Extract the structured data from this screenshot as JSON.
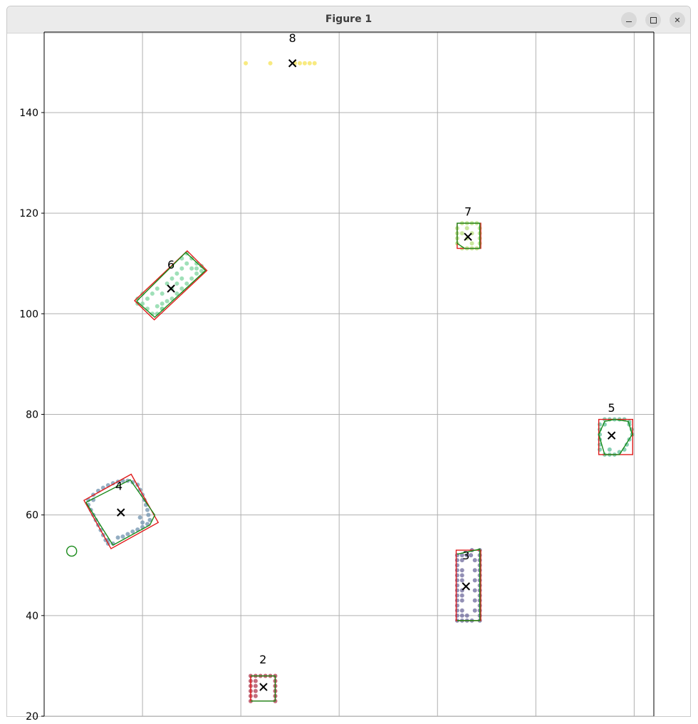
{
  "window": {
    "title": "Figure 1"
  },
  "controls": {
    "minimize": "minimize",
    "maximize": "maximize",
    "close": "close"
  },
  "chart_data": {
    "type": "scatter",
    "title": "",
    "xlabel": "",
    "ylabel": "",
    "xlim": [
      -4,
      120
    ],
    "ylim": [
      20,
      156
    ],
    "grid": true,
    "x_ticks": [
      16,
      36,
      56,
      76,
      96,
      116
    ],
    "y_ticks": [
      20,
      40,
      60,
      80,
      100,
      120,
      140
    ],
    "y_tick_labels": [
      "20",
      "40",
      "60",
      "80",
      "100",
      "120",
      "140"
    ],
    "colors": {
      "cluster_2": "#b13c52",
      "cluster_3": "#6d6a9c",
      "cluster_4": "#6f92ae",
      "cluster_5": "#5fbf9a",
      "cluster_6": "#7fd6a0",
      "cluster_7": "#b8df7d",
      "cluster_8": "#f5e356",
      "bounding_box": "#e01b1b",
      "hull": "#1a8a1a",
      "centroid": "#000000",
      "extra_circle": "#1a8a1a"
    },
    "extra_points": [
      {
        "x": 1.6,
        "y": 52.8,
        "marker": "open-circle"
      }
    ],
    "clusters": [
      {
        "label": "2",
        "centroid": [
          40.6,
          25.8
        ],
        "label_pos": [
          40.5,
          30.5
        ],
        "box": [
          [
            38,
            23
          ],
          [
            43,
            23
          ],
          [
            43,
            28
          ],
          [
            38,
            28
          ]
        ],
        "hull": [
          [
            38,
            23
          ],
          [
            43,
            23
          ],
          [
            43,
            28
          ],
          [
            38,
            28
          ]
        ],
        "points": [
          [
            38,
            23
          ],
          [
            38,
            24
          ],
          [
            38,
            25
          ],
          [
            38,
            26
          ],
          [
            38,
            27
          ],
          [
            38,
            28
          ],
          [
            39,
            28
          ],
          [
            40,
            28
          ],
          [
            41,
            28
          ],
          [
            42,
            28
          ],
          [
            43,
            28
          ],
          [
            43,
            27
          ],
          [
            43,
            26
          ],
          [
            43,
            25
          ],
          [
            43,
            24
          ],
          [
            43,
            23
          ],
          [
            39,
            24
          ],
          [
            39,
            25
          ],
          [
            39,
            26
          ],
          [
            39,
            27
          ]
        ]
      },
      {
        "label": "3",
        "centroid": [
          81.8,
          45.8
        ],
        "label_pos": [
          81.8,
          51.2
        ],
        "box": [
          [
            79.8,
            39
          ],
          [
            84.8,
            39
          ],
          [
            84.8,
            53
          ],
          [
            79.8,
            53
          ]
        ],
        "hull": [
          [
            80,
            39
          ],
          [
            84.6,
            39
          ],
          [
            84.6,
            53.2
          ],
          [
            80,
            52.2
          ]
        ],
        "points": [
          [
            80,
            39
          ],
          [
            80,
            40
          ],
          [
            80,
            41
          ],
          [
            80,
            42
          ],
          [
            80,
            43
          ],
          [
            80,
            44
          ],
          [
            80,
            45
          ],
          [
            80,
            46
          ],
          [
            80,
            47
          ],
          [
            80,
            48
          ],
          [
            80,
            49
          ],
          [
            80,
            50
          ],
          [
            80,
            51
          ],
          [
            80,
            52
          ],
          [
            84.6,
            39
          ],
          [
            84.6,
            40
          ],
          [
            84.6,
            41
          ],
          [
            84.6,
            42
          ],
          [
            84.6,
            43
          ],
          [
            84.6,
            44
          ],
          [
            84.6,
            45
          ],
          [
            84.6,
            46
          ],
          [
            84.6,
            47
          ],
          [
            84.6,
            48
          ],
          [
            84.6,
            49
          ],
          [
            84.6,
            50
          ],
          [
            84.6,
            51
          ],
          [
            84.6,
            52
          ],
          [
            84.6,
            53
          ],
          [
            81,
            39
          ],
          [
            82,
            39
          ],
          [
            83,
            39
          ],
          [
            81,
            52
          ],
          [
            82,
            52
          ],
          [
            83,
            53
          ],
          [
            81,
            41
          ],
          [
            81,
            43
          ],
          [
            81,
            45
          ],
          [
            81,
            47
          ],
          [
            81,
            49
          ],
          [
            81,
            51
          ],
          [
            83.6,
            41
          ],
          [
            83.6,
            43
          ],
          [
            83.6,
            45
          ],
          [
            83.6,
            47
          ],
          [
            83.6,
            49
          ],
          [
            83.6,
            51
          ],
          [
            81,
            40
          ],
          [
            81,
            44
          ],
          [
            81,
            48
          ],
          [
            82,
            40
          ],
          [
            82.8,
            52
          ]
        ]
      },
      {
        "label": "4",
        "centroid": [
          11.6,
          60.5
        ],
        "label_pos": [
          11.2,
          65
        ],
        "box": [
          [
            4.1,
            62.9
          ],
          [
            13.7,
            68.1
          ],
          [
            19.2,
            58.5
          ],
          [
            9.6,
            53.3
          ]
        ],
        "hull": [
          [
            4.5,
            62.5
          ],
          [
            13.5,
            67
          ],
          [
            18.5,
            60
          ],
          [
            17.5,
            58
          ],
          [
            10,
            54
          ],
          [
            4.5,
            62.5
          ]
        ],
        "points": [
          [
            5,
            63
          ],
          [
            6,
            64
          ],
          [
            7,
            64.8
          ],
          [
            8,
            65.4
          ],
          [
            9,
            65.9
          ],
          [
            10,
            66.3
          ],
          [
            11,
            66.6
          ],
          [
            12,
            66.8
          ],
          [
            13,
            66.8
          ],
          [
            5,
            62
          ],
          [
            5.5,
            61
          ],
          [
            6,
            60
          ],
          [
            6.5,
            59
          ],
          [
            7,
            58
          ],
          [
            7.5,
            57
          ],
          [
            8,
            56
          ],
          [
            8.5,
            55
          ],
          [
            9,
            54.3
          ],
          [
            10,
            54.3
          ],
          [
            11,
            55.5
          ],
          [
            12,
            55.7
          ],
          [
            13,
            56.2
          ],
          [
            14,
            56.7
          ],
          [
            15,
            57.1
          ],
          [
            16,
            57.6
          ],
          [
            17,
            58.2
          ],
          [
            17.5,
            59
          ],
          [
            17.2,
            60
          ],
          [
            17,
            61
          ],
          [
            16.7,
            62
          ],
          [
            16.4,
            63
          ],
          [
            16,
            64
          ],
          [
            15.5,
            65
          ],
          [
            15,
            66
          ],
          [
            14,
            66.5
          ],
          [
            6,
            63
          ],
          [
            9,
            55
          ],
          [
            16,
            58.5
          ],
          [
            15.5,
            59.5
          ]
        ]
      },
      {
        "label": "5",
        "centroid": [
          111.4,
          75.8
        ],
        "label_pos": [
          111.4,
          80.5
        ],
        "box": [
          [
            108.8,
            72
          ],
          [
            115.7,
            72
          ],
          [
            115.7,
            79
          ],
          [
            108.8,
            79
          ]
        ],
        "hull": [
          [
            110,
            72
          ],
          [
            113,
            72
          ],
          [
            115.6,
            76
          ],
          [
            114.8,
            78.6
          ],
          [
            112,
            79
          ],
          [
            110,
            78.6
          ],
          [
            108.8,
            76
          ],
          [
            110,
            72
          ]
        ],
        "points": [
          [
            109,
            73
          ],
          [
            109,
            74
          ],
          [
            109,
            75
          ],
          [
            109,
            76
          ],
          [
            109,
            77
          ],
          [
            109,
            78
          ],
          [
            110,
            72
          ],
          [
            111,
            72
          ],
          [
            112,
            72
          ],
          [
            110,
            79
          ],
          [
            111,
            79
          ],
          [
            112,
            79
          ],
          [
            113,
            79
          ],
          [
            114,
            79
          ],
          [
            115,
            78
          ],
          [
            115.5,
            77
          ],
          [
            115.6,
            76
          ],
          [
            115,
            75
          ],
          [
            114.5,
            74
          ],
          [
            114,
            73
          ],
          [
            113,
            72.5
          ],
          [
            110,
            78
          ],
          [
            111,
            73
          ],
          [
            115,
            78.5
          ]
        ]
      },
      {
        "label": "6",
        "centroid": [
          21.8,
          105
        ],
        "label_pos": [
          21.8,
          109
        ],
        "box": [
          [
            14.4,
            102.6
          ],
          [
            18.4,
            98.8
          ],
          [
            29.1,
            108.6
          ],
          [
            25.1,
            112.5
          ]
        ],
        "hull": [
          [
            14.8,
            102.5
          ],
          [
            18.5,
            99.3
          ],
          [
            28.8,
            108.6
          ],
          [
            24.8,
            112.2
          ],
          [
            14.8,
            102.5
          ]
        ],
        "points": [
          [
            15,
            103
          ],
          [
            16,
            102
          ],
          [
            17,
            101
          ],
          [
            18,
            100
          ],
          [
            19,
            100
          ],
          [
            20,
            101
          ],
          [
            16,
            104
          ],
          [
            17,
            103
          ],
          [
            15,
            102
          ],
          [
            19,
            101.5
          ],
          [
            20,
            102
          ],
          [
            21,
            102.5
          ],
          [
            22,
            103
          ],
          [
            23,
            104
          ],
          [
            24,
            105
          ],
          [
            25,
            106
          ],
          [
            26,
            107
          ],
          [
            27,
            108
          ],
          [
            28,
            108.5
          ],
          [
            26,
            109
          ],
          [
            25,
            110
          ],
          [
            24,
            111
          ],
          [
            25,
            112
          ],
          [
            26,
            111
          ],
          [
            27,
            110
          ],
          [
            28,
            109.5
          ],
          [
            22,
            105
          ],
          [
            21,
            106
          ],
          [
            20,
            104
          ],
          [
            23,
            106
          ],
          [
            24,
            107
          ],
          [
            22,
            107
          ],
          [
            23,
            108
          ],
          [
            24,
            109
          ],
          [
            27,
            109
          ],
          [
            20,
            101
          ],
          [
            18,
            104
          ],
          [
            19,
            105
          ]
        ]
      },
      {
        "label": "7",
        "centroid": [
          82.2,
          115.3
        ],
        "label_pos": [
          82.2,
          119.5
        ],
        "box": [
          [
            80,
            113
          ],
          [
            84.8,
            113
          ],
          [
            84.8,
            118
          ],
          [
            80,
            118
          ]
        ],
        "hull": [
          [
            80,
            114
          ],
          [
            81.5,
            113
          ],
          [
            84.6,
            113
          ],
          [
            84.6,
            118
          ],
          [
            80,
            118
          ],
          [
            80,
            114
          ]
        ],
        "points": [
          [
            80,
            114
          ],
          [
            80,
            115
          ],
          [
            80,
            116
          ],
          [
            80,
            117
          ],
          [
            81,
            113
          ],
          [
            82,
            113
          ],
          [
            83,
            113
          ],
          [
            84,
            113
          ],
          [
            81,
            118
          ],
          [
            82,
            118
          ],
          [
            83,
            118
          ],
          [
            84,
            118
          ],
          [
            84.6,
            114
          ],
          [
            84.6,
            115
          ],
          [
            84.6,
            116
          ],
          [
            84.6,
            117
          ],
          [
            81,
            116
          ],
          [
            82,
            115
          ],
          [
            83,
            116
          ],
          [
            82,
            117
          ],
          [
            83,
            114
          ]
        ]
      },
      {
        "label": "8",
        "centroid": [
          46.5,
          149.8
        ],
        "label_pos": [
          46.5,
          154
        ],
        "box": null,
        "hull": null,
        "points": [
          [
            37,
            149.8
          ],
          [
            42,
            149.8
          ],
          [
            47,
            149.8
          ],
          [
            48,
            149.8
          ],
          [
            49,
            149.8
          ],
          [
            50,
            149.8
          ],
          [
            51,
            149.8
          ]
        ]
      }
    ]
  }
}
